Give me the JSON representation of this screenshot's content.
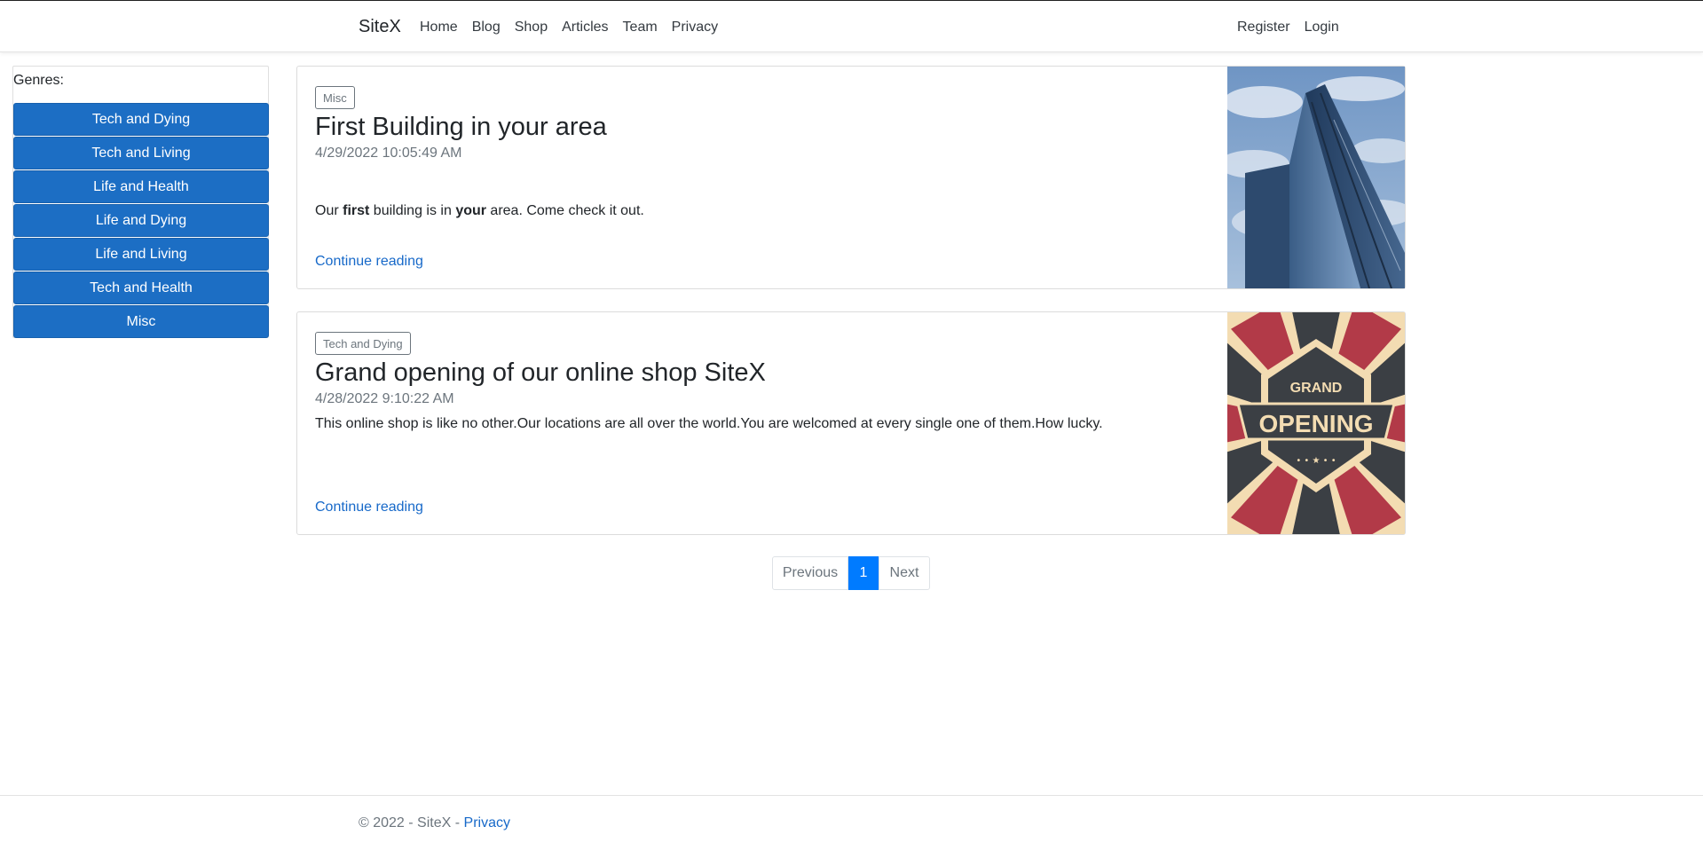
{
  "nav": {
    "brand": "SiteX",
    "links": [
      "Home",
      "Blog",
      "Shop",
      "Articles",
      "Team",
      "Privacy"
    ],
    "right_links": [
      "Register",
      "Login"
    ]
  },
  "sidebar": {
    "label": "Genres:",
    "genres": [
      "Tech and Dying",
      "Tech and Living",
      "Life and Health",
      "Life and Dying",
      "Life and Living",
      "Tech and Health",
      "Misc"
    ]
  },
  "posts": [
    {
      "badge": "Misc",
      "title": "First Building in your area",
      "date": "4/29/2022 10:05:49 AM",
      "text_before_first": "Our ",
      "text_first": "first",
      "text_mid": " building is in ",
      "text_your": "your",
      "text_after": " area. Come check it out.",
      "link": "Continue reading",
      "image": "skyscraper-photo"
    },
    {
      "badge": "Tech and Dying",
      "title": "Grand opening of our online shop SiteX",
      "date": "4/28/2022 9:10:22 AM",
      "text": "This online shop is like no other.Our locations are all over the world.You are welcomed at every single one of them.How lucky.",
      "link": "Continue reading",
      "image": "grand-opening-poster",
      "image_text_top": "GRAND",
      "image_text_main": "OPENING"
    }
  ],
  "pagination": {
    "previous": "Previous",
    "current": "1",
    "next": "Next"
  },
  "footer": {
    "text": "© 2022 - SiteX - ",
    "link": "Privacy"
  },
  "colors": {
    "genre_button": "#1c6ec4",
    "link": "#1769c9",
    "active_page": "#007bff"
  }
}
